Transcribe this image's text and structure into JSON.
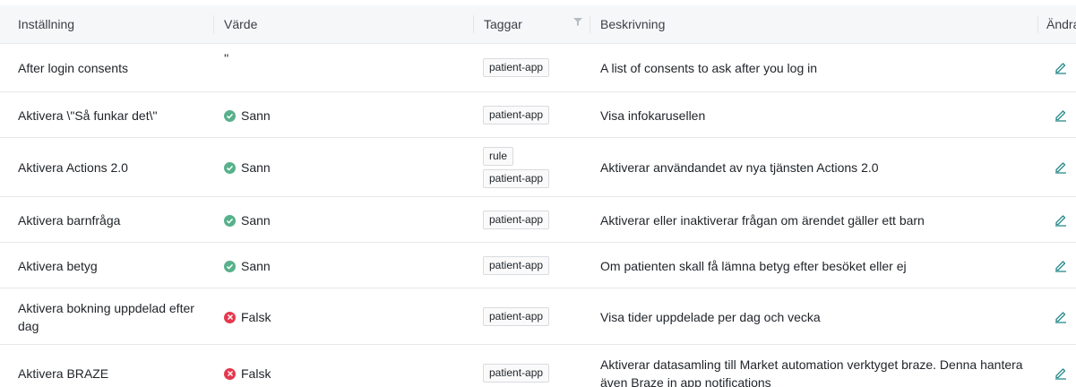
{
  "table": {
    "headers": {
      "setting": "Inställning",
      "value": "Värde",
      "tags": "Taggar",
      "description": "Beskrivning",
      "edit": "Ändra"
    },
    "rows": [
      {
        "setting": "After login consents",
        "value": "''",
        "value_type": "raw",
        "tags": [
          "patient-app"
        ],
        "description": "A list of consents to ask after you log in"
      },
      {
        "setting": "Aktivera \\\"Så funkar det\\\"",
        "value": "Sann",
        "value_type": "true",
        "tags": [
          "patient-app"
        ],
        "description": "Visa infokarusellen"
      },
      {
        "setting": "Aktivera Actions 2.0",
        "value": "Sann",
        "value_type": "true",
        "tags": [
          "rule",
          "patient-app"
        ],
        "description": "Aktiverar användandet av nya tjänsten Actions 2.0"
      },
      {
        "setting": "Aktivera barnfråga",
        "value": "Sann",
        "value_type": "true",
        "tags": [
          "patient-app"
        ],
        "description": "Aktiverar eller inaktiverar frågan om ärendet gäller ett barn"
      },
      {
        "setting": "Aktivera betyg",
        "value": "Sann",
        "value_type": "true",
        "tags": [
          "patient-app"
        ],
        "description": "Om patienten skall få lämna betyg efter besöket eller ej"
      },
      {
        "setting_line1": "Aktivera bokning uppdelad efter",
        "setting_line2": "dag",
        "value": "Falsk",
        "value_type": "false",
        "tags": [
          "patient-app"
        ],
        "description": "Visa tider uppdelade per dag och vecka"
      },
      {
        "setting": "Aktivera BRAZE",
        "value": "Falsk",
        "value_type": "false",
        "tags": [
          "patient-app"
        ],
        "description_line1": "Aktiverar datasamling till Market automation verktyget braze. Denna hantera",
        "description_line2": "även Braze in app notifications"
      }
    ]
  },
  "colors": {
    "true_status": "#57b18a",
    "false_status": "#e5384d",
    "edit_icon": "#2a8a8a"
  },
  "icons": {
    "filter": "filter-icon",
    "edit": "edit-pencil-icon",
    "true": "check-circle-icon",
    "false": "x-circle-icon"
  }
}
